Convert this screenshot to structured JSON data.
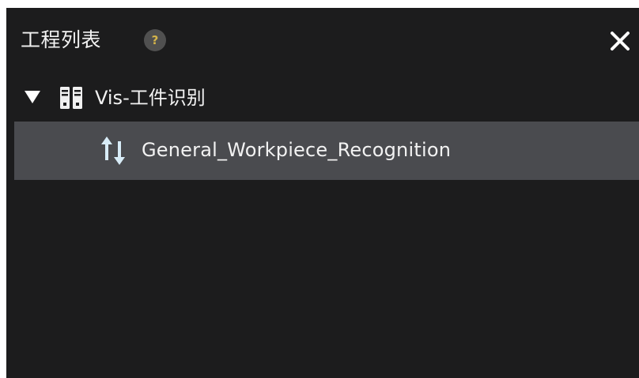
{
  "panel": {
    "title": "工程列表",
    "help_label": "?",
    "close_icon": "close-icon"
  },
  "tree": {
    "project": {
      "label": "Vis-工件识别",
      "expanded": true,
      "expand_icon": "triangle-down-icon",
      "icon": "project-icon"
    },
    "workflows": [
      {
        "label": "General_Workpiece_Recognition",
        "icon": "workflow-arrows-icon",
        "selected": true
      }
    ]
  },
  "colors": {
    "panel_background": "#1c1c1d",
    "selected_row": "#4a4b4f",
    "text": "#f2f2f2",
    "icon_accent": "#d8ecf7",
    "help_icon_fg": "#d4b44a"
  }
}
